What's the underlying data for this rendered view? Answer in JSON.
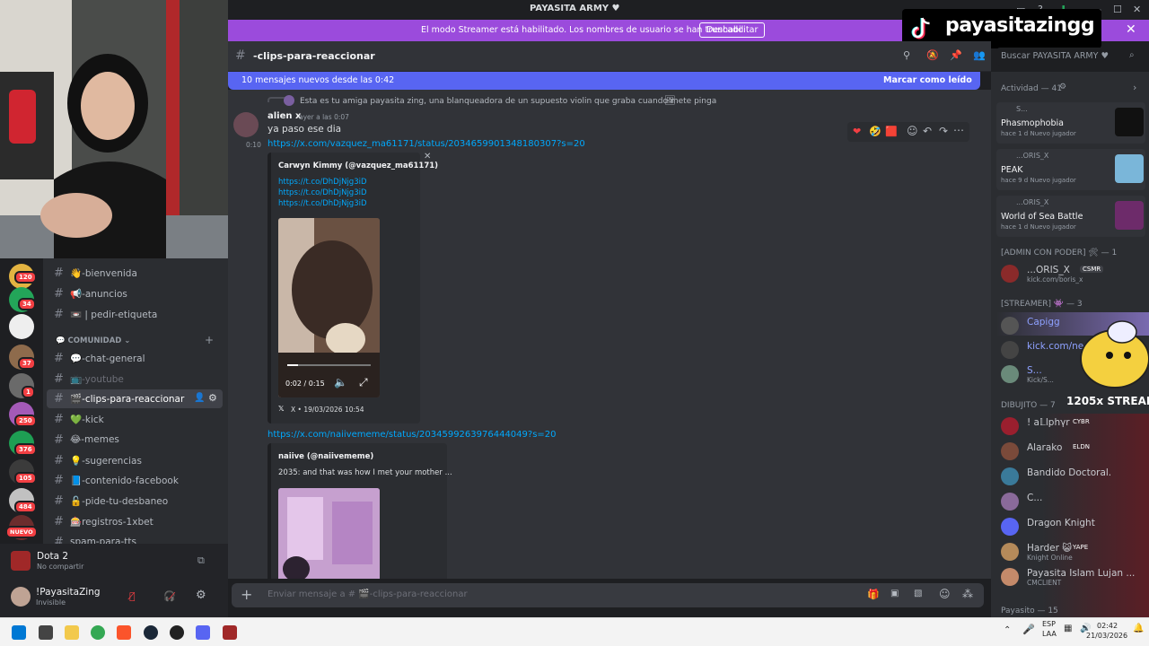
{
  "window": {
    "title": "PAYASITA ARMY ♥"
  },
  "streamer_banner": {
    "message": "El modo Streamer está habilitado. Los nombres de usuario se han truncado.",
    "button": "Deshabilitar"
  },
  "overlay": {
    "tiktok_name": "payasitazingg",
    "streak": "1205x STREAK"
  },
  "channel_header": {
    "name": "-clips-para-reaccionar",
    "search_placeholder": "Buscar PAYASITA ARMY ♥"
  },
  "new_messages": {
    "text": "10 mensajes nuevos desde las 0:42",
    "mark_read": "Marcar como leído"
  },
  "server_badges": [
    "120",
    "34",
    "37",
    "1",
    "250",
    "376",
    "105",
    "484",
    "NUEVO"
  ],
  "channels": {
    "top": [
      {
        "label": "👋-bienvenida"
      },
      {
        "label": "📢-anuncios"
      },
      {
        "label": "📼 | pedir-etiqueta"
      }
    ],
    "category": "COMUNIDAD",
    "community": [
      {
        "label": "💬-chat-general",
        "state": "normal"
      },
      {
        "label": "📺-youtube",
        "state": "muted"
      },
      {
        "label": "🎬-clips-para-reaccionar",
        "state": "active"
      },
      {
        "label": "💚-kick",
        "state": "normal"
      },
      {
        "label": "😂-memes",
        "state": "normal"
      },
      {
        "label": "💡-sugerencias",
        "state": "normal"
      },
      {
        "label": "📘-contenido-facebook",
        "state": "normal"
      },
      {
        "label": "🔓-pide-tu-desbaneo",
        "state": "normal"
      },
      {
        "label": "🎰registros-1xbet",
        "state": "normal"
      },
      {
        "label": "spam-para-tts",
        "state": "normal"
      }
    ]
  },
  "activity": {
    "game": "Dota 2",
    "sub": "No compartir"
  },
  "user": {
    "name": "!PayasitaZing",
    "status": "Invisible"
  },
  "messages": {
    "reply_preview": "Esta es tu amiga payasita zing, una blanqueadora de un supuesto violin que graba cuando mete pinga",
    "author": "alien x",
    "timestamp": "ayer a las 0:07",
    "text": "ya paso ese dia",
    "time2": "0:10",
    "link1": "https://x.com/vazquez_ma61171/status/2034659901348180307?s=20",
    "embed1": {
      "author": "Carwyn Kimmy (@vazquez_ma61171)",
      "links": [
        "https://t.co/DhDjNjg3iD",
        "https://t.co/DhDjNjg3iD",
        "https://t.co/DhDjNjg3iD"
      ],
      "video_time": "0:02 / 0:15",
      "footer": "X • 19/03/2026 10:54"
    },
    "link2": "https://x.com/naiivememe/status/2034599263976444049?s=20",
    "embed2": {
      "author": "naiive (@naiivememe)",
      "text": "2035: and that was how I met your mother ..."
    }
  },
  "composer": {
    "placeholder": "Enviar mensaje a # 🎬-clips-para-reaccionar"
  },
  "members": {
    "activity_header": "Actividad — 41",
    "activity": [
      {
        "name": "S...",
        "game": "Phasmophobia",
        "sub": "hace 1 d  Nuevo jugador"
      },
      {
        "name": "...ORIS_X",
        "game": "PEAK",
        "sub": "hace 9 d  Nuevo jugador"
      },
      {
        "name": "...ORIS_X",
        "game": "World of Sea Battle",
        "sub": "hace 1 d  Nuevo jugador"
      }
    ],
    "admin_header": "[ADMIN CON PODER] 🛠 — 1",
    "admin": [
      {
        "name": "...ORIS_X",
        "tag": "CSMR",
        "sub": "kick.com/boris_x"
      }
    ],
    "streamer_header": "[STREAMER] 👾 — 3",
    "streamers": [
      {
        "name": "Capigg",
        "sub": ""
      },
      {
        "name": "kick.com/ne...",
        "sub": ""
      },
      {
        "name": "S...",
        "sub": "Kick/S..."
      }
    ],
    "dibujito_header": "DIBUJITO — 7",
    "dibujito": [
      {
        "name": "! a𝕃lphγr",
        "tag": "CYBR",
        "sub": ""
      },
      {
        "name": "Alarako",
        "tag": "ELDN",
        "sub": ""
      },
      {
        "name": "Bandido Doctoral.",
        "tag": "",
        "sub": ""
      },
      {
        "name": "C...",
        "tag": "",
        "sub": ""
      },
      {
        "name": "Dragon Knight",
        "tag": "",
        "sub": ""
      },
      {
        "name": "Harder 😺",
        "tag": "YAPE",
        "sub": "Knight Online"
      },
      {
        "name": "Payasita Islam Lujan ...",
        "tag": "",
        "sub": "CMCLIENT"
      }
    ],
    "payasito_header": "Payasito — 15"
  },
  "taskbar": {
    "lang": "ESP",
    "lang2": "LAA",
    "time": "02:42",
    "date": "21/03/2026"
  }
}
